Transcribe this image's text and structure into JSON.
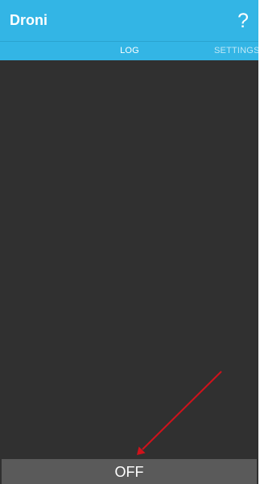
{
  "app_bar": {
    "title": "Droni",
    "help_label": "?"
  },
  "tabs": [
    {
      "label": "LOG",
      "selected": true
    },
    {
      "label": "SETTINGS",
      "selected": false
    }
  ],
  "power_button": {
    "label": "OFF"
  },
  "colors": {
    "app_bar": "#33b5e5",
    "background": "#303030",
    "button": "#5a5a5a",
    "annotation_arrow": "#d0121b"
  },
  "icons": {
    "help": "help-icon"
  }
}
